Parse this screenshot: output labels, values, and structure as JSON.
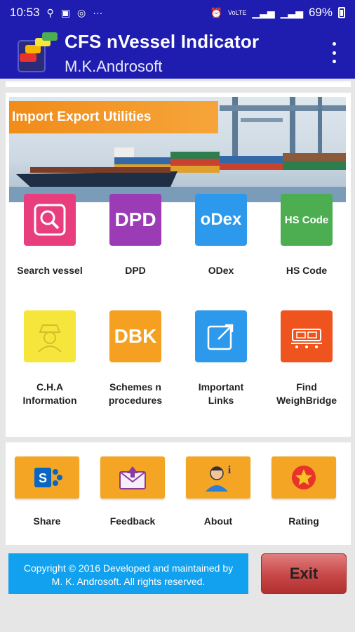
{
  "status_bar": {
    "time": "10:53",
    "battery_percent": "69%",
    "icons": [
      "usb-icon",
      "image-icon",
      "instagram-icon",
      "more-icon",
      "alarm-icon",
      "volte-icon",
      "signal-icon",
      "signal-icon",
      "battery-icon"
    ]
  },
  "app_bar": {
    "title": "CFS nVessel Indicator",
    "subtitle": "M.K.Androsoft"
  },
  "banner": {
    "title": "Import Export Utilities"
  },
  "tiles": [
    {
      "label": "Search vessel",
      "text": "",
      "color": "#e83e7d"
    },
    {
      "label": "DPD",
      "text": "DPD",
      "color": "#9b3bb5"
    },
    {
      "label": "ODex",
      "text": "oDex",
      "color": "#2d99ec"
    },
    {
      "label": "HS Code",
      "text": "HS Code",
      "color": "#4cae50"
    },
    {
      "label1": "C.H.A",
      "label2": "Information",
      "text": "",
      "color": "#f6e63b"
    },
    {
      "label1": "Schemes n",
      "label2": "procedures",
      "text": "DBK",
      "color": "#f5a020"
    },
    {
      "label1": "Important",
      "label2": "Links",
      "text": "",
      "color": "#2d99ec"
    },
    {
      "label1": "Find",
      "label2": "WeighBridge",
      "text": "",
      "color": "#f0541e"
    }
  ],
  "bottom": {
    "share": "Share",
    "feedback": "Feedback",
    "about": "About",
    "rating": "Rating"
  },
  "footer": {
    "copyright_line1": "Copyright © 2016 Developed and maintained by",
    "copyright_line2": "M. K. Androsoft. All rights reserved.",
    "exit_label": "Exit"
  }
}
